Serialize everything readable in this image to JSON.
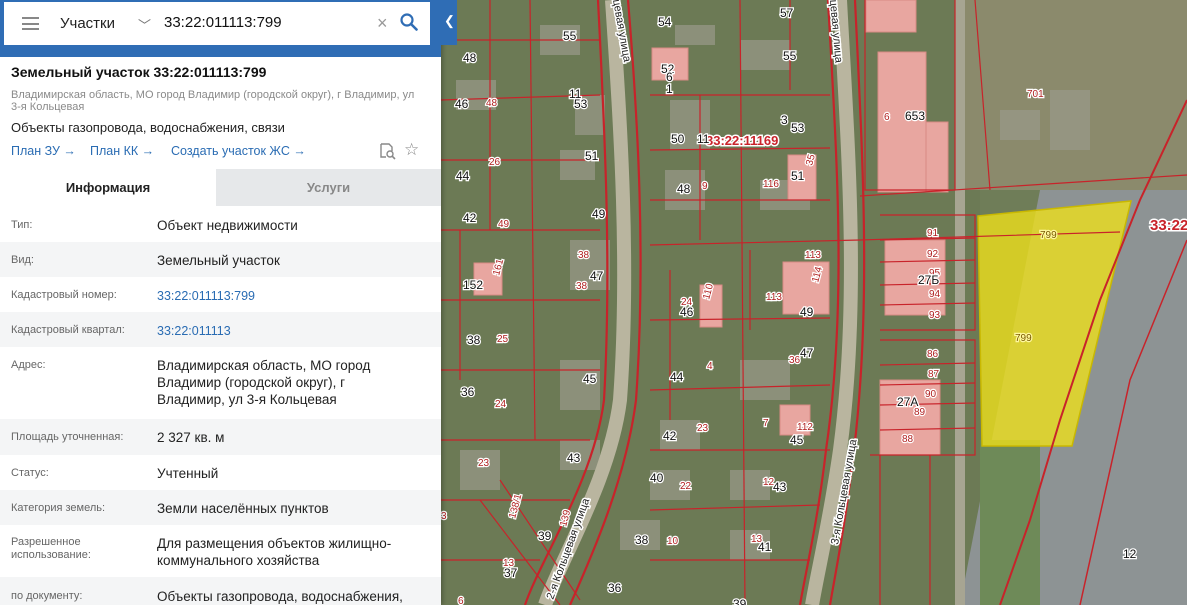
{
  "search": {
    "scope": "Участки",
    "query": "33:22:011113:799"
  },
  "parcel": {
    "title": "Земельный участок 33:22:011113:799",
    "address": "Владимирская область, МО город Владимир (городской округ), г Владимир, ул 3-я Кольцевая",
    "purpose": "Объекты газопровода, водоснабжения, связи",
    "links": [
      "План ЗУ →",
      "План КК →",
      "Создать участок ЖС →"
    ]
  },
  "tabs": {
    "info": "Информация",
    "services": "Услуги"
  },
  "info": [
    {
      "label": "Тип:",
      "value": "Объект недвижимости"
    },
    {
      "label": "Вид:",
      "value": "Земельный участок"
    },
    {
      "label": "Кадастровый номер:",
      "value": "33:22:011113:799"
    },
    {
      "label": "Кадастровый квартал:",
      "value": "33:22:011113"
    },
    {
      "label": "Адрес:",
      "value": "Владимирская область, МО город Владимир (городской округ), г Владимир, ул 3-я Кольцевая"
    },
    {
      "label": "Площадь уточненная:",
      "value": "2 327 кв. м"
    },
    {
      "label": "Статус:",
      "value": "Учтенный"
    },
    {
      "label": "Категория земель:",
      "value": "Земли населённых пунктов"
    },
    {
      "label": "Разрешенное использование:",
      "value": "Для размещения объектов жилищно-коммунального хозяйства"
    },
    {
      "label": "по документу:",
      "value": "Объекты газопровода, водоснабжения,"
    }
  ],
  "map": {
    "quarter_labels": [
      "33:22:11169",
      "33:22"
    ],
    "street_labels": [
      "3-я Кольцевая улица",
      "2-я Кольцевая улица",
      "цевая улица",
      "цевая улица"
    ],
    "parcel_labels": [
      "48",
      "55",
      "54",
      "57",
      "46",
      "48",
      "11",
      "53",
      "52",
      "6",
      "55",
      "1",
      "26",
      "51",
      "50",
      "11",
      "3",
      "53",
      "6",
      "653",
      "701",
      "44",
      "51",
      "48",
      "9",
      "116",
      "51",
      "35",
      "42",
      "49",
      "49",
      "91",
      "92",
      "38",
      "47",
      "113",
      "95",
      "27Б",
      "152",
      "161",
      "38",
      "24",
      "46",
      "110",
      "113",
      "114",
      "94",
      "38",
      "25",
      "49",
      "93",
      "799",
      "799",
      "47",
      "36",
      "86",
      "45",
      "44",
      "4",
      "87",
      "36",
      "24",
      "90",
      "27А",
      "89",
      "23",
      "42",
      "23",
      "7",
      "112",
      "45",
      "88",
      "43",
      "40",
      "22",
      "12",
      "43",
      "39",
      "138/1",
      "139",
      "38",
      "10",
      "13",
      "41",
      "13",
      "37",
      "36",
      "39",
      "12",
      "3",
      "6",
      "2"
    ],
    "colors": {
      "boundary": "#c8232a",
      "selected_fill": "#f0e21a",
      "selected_stroke": "#c9b800",
      "building": "#e8a6a0",
      "panel_blue": "#2f6db5"
    }
  }
}
